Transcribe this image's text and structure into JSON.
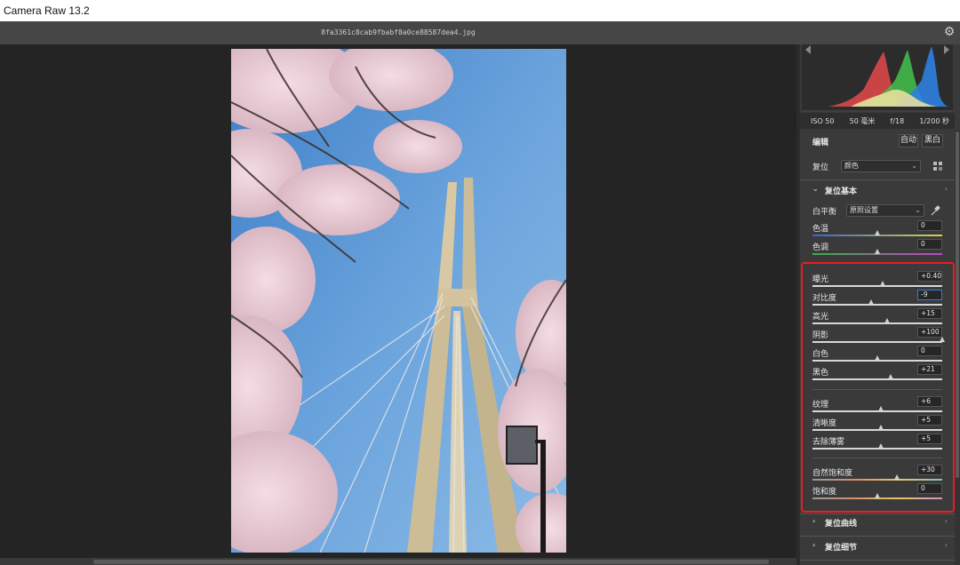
{
  "window": {
    "title": "Camera Raw 13.2"
  },
  "topbar": {
    "filename": "8fa3361c8cab9fbabf8a0ce88587dea4.jpg",
    "settings_icon": "gear-icon"
  },
  "camera_info": {
    "iso": "ISO 50",
    "focal": "50 毫米",
    "aperture": "f/18",
    "shutter": "1/200 秒"
  },
  "edit": {
    "title": "编辑",
    "auto_label": "自动",
    "bw_label": "黑白",
    "profile_label": "复位",
    "profile_value": "颜色"
  },
  "basic": {
    "section_title": "复位基本",
    "wb_label": "白平衡",
    "wb_value": "原照设置",
    "sliders": [
      {
        "key": "temp",
        "label": "色温",
        "value": "0",
        "pos": 0.5
      },
      {
        "key": "tint",
        "label": "色调",
        "value": "0",
        "pos": 0.5
      },
      {
        "key": "exposure",
        "label": "曝光",
        "value": "+0.40",
        "pos": 0.54
      },
      {
        "key": "contrast",
        "label": "对比度",
        "value": "-9",
        "pos": 0.455
      },
      {
        "key": "highlights",
        "label": "高光",
        "value": "+15",
        "pos": 0.575
      },
      {
        "key": "shadows",
        "label": "阴影",
        "value": "+100",
        "pos": 1.0
      },
      {
        "key": "whites",
        "label": "白色",
        "value": "0",
        "pos": 0.5
      },
      {
        "key": "blacks",
        "label": "黑色",
        "value": "+21",
        "pos": 0.605
      },
      {
        "key": "texture",
        "label": "纹理",
        "value": "+6",
        "pos": 0.53
      },
      {
        "key": "clarity",
        "label": "清晰度",
        "value": "+5",
        "pos": 0.525
      },
      {
        "key": "dehaze",
        "label": "去除薄雾",
        "value": "+5",
        "pos": 0.525
      },
      {
        "key": "vibrance",
        "label": "自然饱和度",
        "value": "+30",
        "pos": 0.65
      },
      {
        "key": "saturation",
        "label": "饱和度",
        "value": "0",
        "pos": 0.5
      }
    ]
  },
  "collapsed_sections": [
    {
      "title": "复位曲线"
    },
    {
      "title": "复位细节"
    }
  ],
  "colors": {
    "highlight_box": "#e81d22",
    "panel_bg": "#3a3a3a",
    "viewer_bg": "#242424",
    "sky": "#5a95d3"
  }
}
